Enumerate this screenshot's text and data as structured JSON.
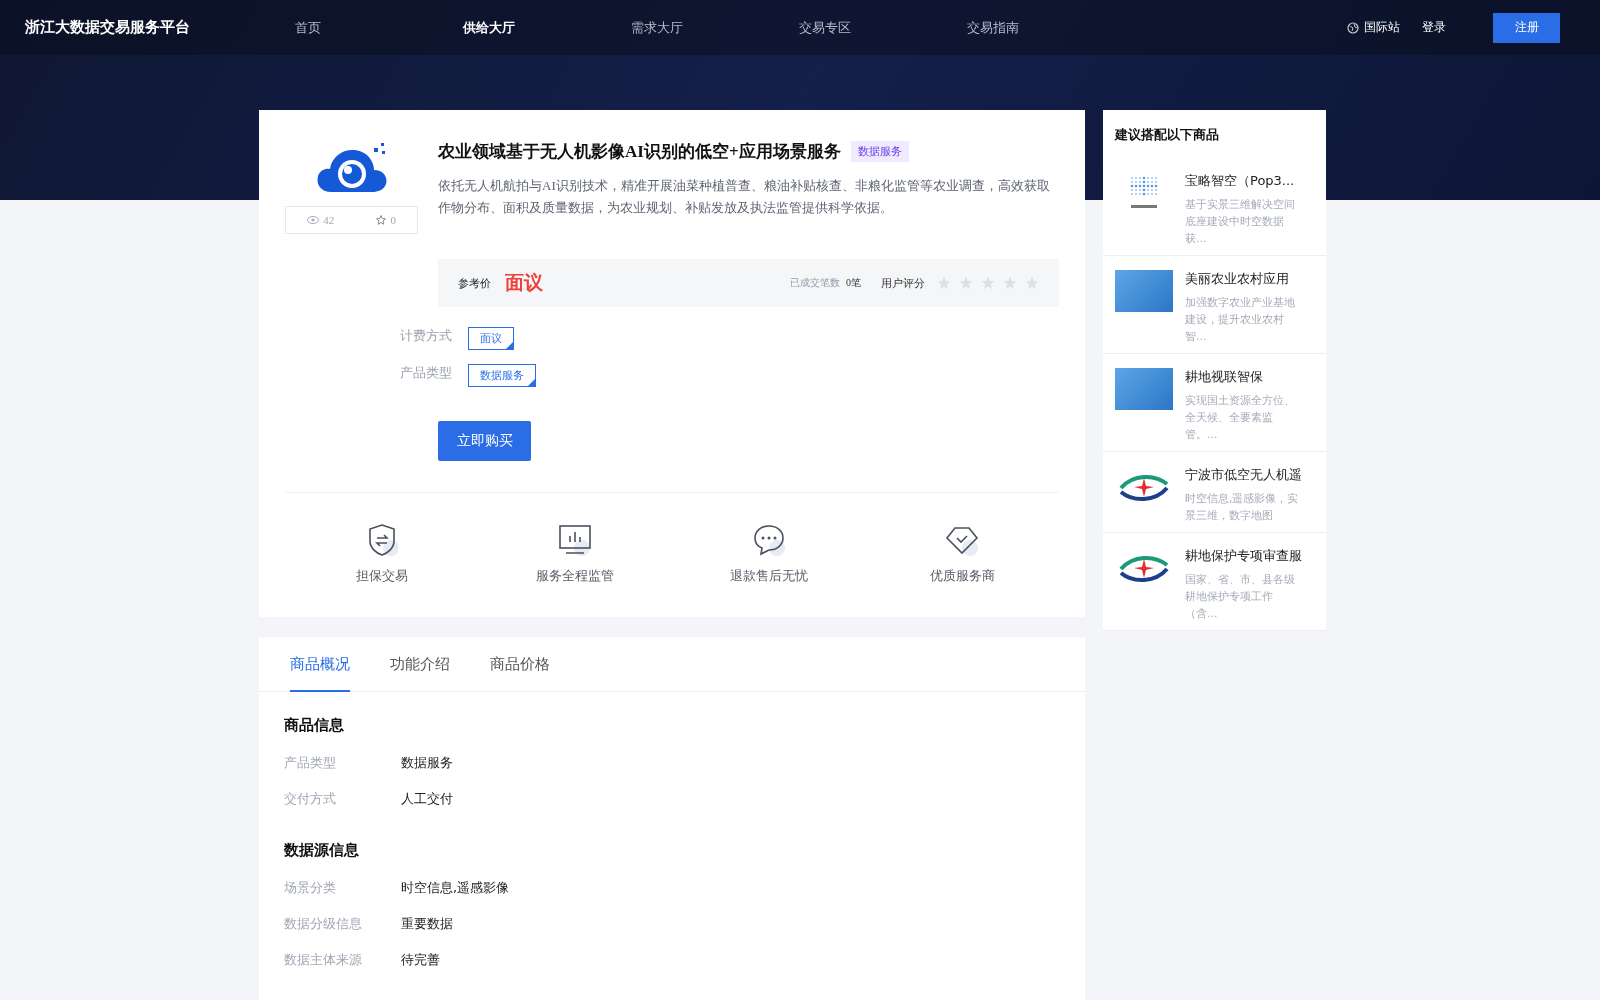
{
  "header": {
    "logo": "浙江大数据交易服务平台",
    "nav": [
      {
        "label": "首页",
        "selected": false
      },
      {
        "label": "供给大厅",
        "selected": true
      },
      {
        "label": "需求大厅",
        "selected": false
      },
      {
        "label": "交易专区",
        "selected": false
      },
      {
        "label": "交易指南",
        "selected": false
      }
    ],
    "international": "国际站",
    "login": "登录",
    "register": "注册"
  },
  "product": {
    "views": "42",
    "favorites": "0",
    "title": "农业领域基于无人机影像AI识别的低空+应用场景服务",
    "tag": "数据服务",
    "description": "依托无人机航拍与AI识别技术，精准开展油菜种植普查、粮油补贴核查、非粮化监管等农业调查，高效获取作物分布、面积及质量数据，为农业规划、补贴发放及执法监管提供科学依据。",
    "price_label": "参考价",
    "price": "面议",
    "deals_label": "已成交笔数",
    "deals": "0笔",
    "rating_label": "用户评分",
    "stars": 0,
    "options": [
      {
        "label": "计费方式",
        "value": "面议"
      },
      {
        "label": "产品类型",
        "value": "数据服务"
      }
    ],
    "buy": "立即购买",
    "guarantees": [
      {
        "kind": "shield",
        "label": "担保交易"
      },
      {
        "kind": "monitor",
        "label": "服务全程监管"
      },
      {
        "kind": "chat",
        "label": "退款售后无忧"
      },
      {
        "kind": "diamond",
        "label": "优质服务商"
      }
    ]
  },
  "details": {
    "tabs": [
      {
        "label": "商品概况",
        "selected": true
      },
      {
        "label": "功能介绍",
        "selected": false
      },
      {
        "label": "商品价格",
        "selected": false
      }
    ],
    "sections": [
      {
        "title": "商品信息",
        "rows": [
          {
            "label": "产品类型",
            "value": "数据服务"
          },
          {
            "label": "交付方式",
            "value": "人工交付"
          }
        ]
      },
      {
        "title": "数据源信息",
        "rows": [
          {
            "label": "场景分类",
            "value": "时空信息,遥感影像"
          },
          {
            "label": "数据分级信息",
            "value": "重要数据"
          },
          {
            "label": "数据主体来源",
            "value": "待完善"
          }
        ]
      }
    ]
  },
  "suggestions": {
    "title": "建议搭配以下商品",
    "items": [
      {
        "kind": "pop3d",
        "title": "宝略智空（Pop3...",
        "description": "基于实景三维解决空间底座建设中时空数据获..."
      },
      {
        "kind": "photo",
        "title": "美丽农业农村应用",
        "description": "加强数字农业产业基地建设，提升农业农村智..."
      },
      {
        "kind": "photo",
        "title": "耕地视联智保",
        "description": "实现国土资源全方位、全天候、全要素监管。..."
      },
      {
        "kind": "emblem",
        "title": "宁波市低空无人机遥",
        "description": "时空信息,遥感影像，实景三维，数字地图"
      },
      {
        "kind": "emblem",
        "title": "耕地保护专项审查服",
        "description": "国家、省、市、县各级耕地保护专项工作（含..."
      }
    ]
  }
}
